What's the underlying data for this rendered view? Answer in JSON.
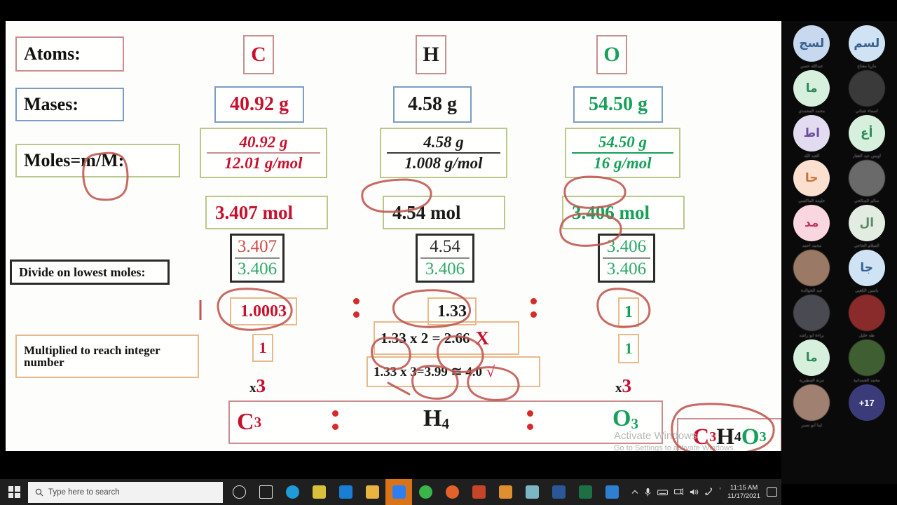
{
  "meta": {
    "app": "video-conference-screenshare",
    "accent_red": "#c8102e",
    "accent_green": "#16a05a",
    "ink_red": "#c0554f"
  },
  "slide": {
    "row_labels": {
      "atoms": "Atoms:",
      "masses": "Mases:",
      "moles": "Moles=m/M:",
      "divide": "Divide on lowest moles:",
      "multiply_line1": "Multiplied to reach integer",
      "multiply_line2": "number"
    },
    "columns": [
      {
        "key": "carbon",
        "symbol": "C",
        "symbol_color": "#c8102e",
        "mass": "40.92 g",
        "mole_numerator": "40.92 g",
        "mole_denominator": "12.01 g/mol",
        "moles": "3.407 mol",
        "divide_numerator": "3.407",
        "divide_denominator": "3.406",
        "ratio": "1.0003",
        "rounded": "1",
        "multiplier": "x 3",
        "multiplier_x": "x",
        "multiplier_n": "3",
        "final": "C",
        "final_sub": "3"
      },
      {
        "key": "hydrogen",
        "symbol": "H",
        "symbol_color": "#1a1a1a",
        "mass": "4.58 g",
        "mole_numerator": "4.58 g",
        "mole_denominator": "1.008 g/mol",
        "moles": "4.54 mol",
        "divide_numerator": "4.54",
        "divide_denominator": "3.406",
        "ratio": "1.33",
        "trial_1": "1.33 x 2 = 2.66",
        "trial_1_mark": "X",
        "trial_2": "1.33 x 3=3.99 ≅ 4.0",
        "trial_2_mark": "√",
        "final": "H",
        "final_sub": "4"
      },
      {
        "key": "oxygen",
        "symbol": "O",
        "symbol_color": "#16a05a",
        "mass": "54.50 g",
        "mole_numerator": "54.50 g",
        "mole_denominator": "16 g/mol",
        "moles": "3.406 mol",
        "divide_numerator": "3.406",
        "divide_denominator": "3.406",
        "ratio": "1",
        "rounded": "1",
        "multiplier": "x 3",
        "multiplier_x": "x",
        "multiplier_n": "3",
        "final": "O",
        "final_sub": "3"
      }
    ],
    "separator": ":",
    "answer": {
      "c": "C",
      "c_sub": "3",
      "h": "H",
      "h_sub": "4",
      "o": "O",
      "o_sub": "3"
    }
  },
  "watermark": {
    "line1": "Activate Windows",
    "line2": "Go to Settings to activate Windows."
  },
  "participants": [
    {
      "initials": "لسج",
      "bg": "#c8d8ef",
      "fg": "#39618f",
      "name": "عبدالله حسن",
      "type": "initials"
    },
    {
      "initials": "لسم",
      "bg": "#cfe3f5",
      "fg": "#39618f",
      "name": "ماريا مفتاح",
      "type": "initials"
    },
    {
      "initials": "ما",
      "bg": "#d7f0dd",
      "fg": "#2f8a5a",
      "name": "محمد المحمدي",
      "type": "initials"
    },
    {
      "initials": "",
      "bg": "#3a3a3a",
      "fg": "#cccccc",
      "name": "أسماء شتاتي",
      "type": "photo",
      "photo": "dark"
    },
    {
      "initials": "اط",
      "bg": "#e3dcf0",
      "fg": "#6a4fa3",
      "name": "العبد الله",
      "type": "initials"
    },
    {
      "initials": "أع",
      "bg": "#d7f0dd",
      "fg": "#2f8a5a",
      "name": "أويس عبد الغفار",
      "type": "initials"
    },
    {
      "initials": "حا",
      "bg": "#fbe0cf",
      "fg": "#c8713a",
      "name": "حليمة الماكسي",
      "type": "initials"
    },
    {
      "initials": "",
      "bg": "#6a6a6a",
      "fg": "#dddddd",
      "name": "سالم الصالحي",
      "type": "photo",
      "photo": "grey"
    },
    {
      "initials": "مد",
      "bg": "#fad6e0",
      "fg": "#c0395f",
      "name": "محمد أحمد",
      "type": "initials"
    },
    {
      "initials": "ال",
      "bg": "#e2ece0",
      "fg": "#5a8a6a",
      "name": "السلام الحاجي",
      "type": "initials"
    },
    {
      "initials": "",
      "bg": "#9a7a66",
      "fg": "#ffffff",
      "name": "عبد الخوالدة",
      "type": "photo",
      "photo": "warm"
    },
    {
      "initials": "جا",
      "bg": "#cfe3f5",
      "fg": "#39618f",
      "name": "ياسين الكعبي",
      "type": "initials"
    },
    {
      "initials": "",
      "bg": "#4a4a52",
      "fg": "#eeeeee",
      "name": "براءة أبو راشد",
      "type": "photo",
      "photo": "night"
    },
    {
      "initials": "",
      "bg": "#8a2b2b",
      "fg": "#ffffff",
      "name": "طه خليل",
      "type": "photo",
      "photo": "red"
    },
    {
      "initials": "ما",
      "bg": "#d7f0dd",
      "fg": "#2f8a5a",
      "name": "مزنة المطيرية",
      "type": "initials"
    },
    {
      "initials": "",
      "bg": "#3f5f33",
      "fg": "#ffffff",
      "name": "محمد الحمدانية",
      "type": "photo",
      "photo": "green"
    },
    {
      "initials": "",
      "bg": "#a08070",
      "fg": "#ffffff",
      "name": "لينا أبو نصير",
      "type": "photo",
      "photo": "warm2"
    },
    {
      "initials": "+17",
      "bg": "#3b3b7a",
      "fg": "#ffffff",
      "name": "",
      "type": "more"
    }
  ],
  "taskbar": {
    "search_placeholder": "Type here to search",
    "clock_time": "11:15 AM",
    "clock_date": "11/17/2021",
    "icons": [
      {
        "name": "cortana-icon",
        "color": "#e2e2e2"
      },
      {
        "name": "task-view-icon",
        "color": "#e2e2e2"
      },
      {
        "name": "microsoft-edge-icon",
        "color": "#1f9cd8"
      },
      {
        "name": "microsoft-store-icon",
        "color": "#d8c03a"
      },
      {
        "name": "mail-icon",
        "color": "#1a7fd4"
      },
      {
        "name": "file-explorer-icon",
        "color": "#e8b340"
      },
      {
        "name": "zoom-icon",
        "color": "#2d7ff0",
        "active": true
      },
      {
        "name": "google-chrome-icon",
        "color": "#3bb44a"
      },
      {
        "name": "firefox-icon",
        "color": "#e4622a"
      },
      {
        "name": "powerpoint-icon",
        "color": "#c5442a"
      },
      {
        "name": "onenote-icon",
        "color": "#e08f2e"
      },
      {
        "name": "browser-icon",
        "color": "#7bb6c4"
      },
      {
        "name": "word-icon",
        "color": "#2b5797"
      },
      {
        "name": "excel-icon",
        "color": "#1d7044"
      },
      {
        "name": "photos-icon",
        "color": "#2f7fd1"
      }
    ],
    "tray": [
      {
        "name": "show-hidden-icons-chevron"
      },
      {
        "name": "microphone-icon"
      },
      {
        "name": "keyboard-icon"
      },
      {
        "name": "network-icon"
      },
      {
        "name": "volume-icon"
      },
      {
        "name": "pen-icon"
      },
      {
        "name": "ime-icon"
      }
    ]
  }
}
